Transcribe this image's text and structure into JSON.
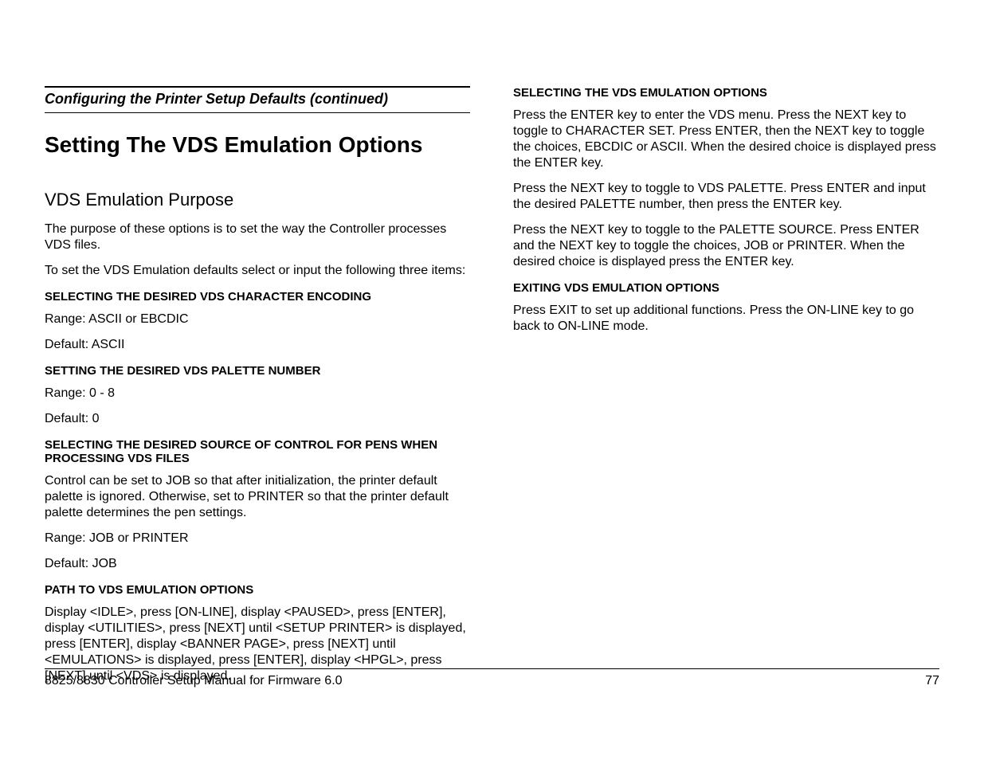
{
  "left": {
    "header": "Configuring the Printer Setup Defaults (continued)",
    "title": "Setting The VDS Emulation Options",
    "subtitle": "VDS Emulation Purpose",
    "p1": "The purpose of these options is to set the way the Controller processes VDS files.",
    "p2": "To set the VDS Emulation defaults select or input the following three items:",
    "s1h": "SELECTING THE DESIRED VDS CHARACTER ENCODING",
    "s1a": "Range: ASCII or EBCDIC",
    "s1b": "Default: ASCII",
    "s2h": "SETTING THE DESIRED VDS PALETTE NUMBER",
    "s2a": "Range: 0 - 8",
    "s2b": "Default: 0",
    "s3h": "SELECTING THE DESIRED SOURCE OF CONTROL FOR PENS WHEN PROCESSING VDS FILES",
    "s3a": "Control can be set to JOB so that after initialization, the printer default palette is ignored. Otherwise, set to PRINTER so that the printer default palette determines the pen settings.",
    "s3b": "Range: JOB or PRINTER",
    "s3c": "Default: JOB",
    "s4h": "PATH TO VDS EMULATION OPTIONS",
    "s4a": "Display <IDLE>, press [ON-LINE], display <PAUSED>, press [ENTER], display <UTILITIES>, press [NEXT] until <SETUP PRINTER> is displayed, press [ENTER], display <BANNER PAGE>, press [NEXT] until <EMULATIONS> is displayed, press [ENTER], display <HPGL>, press [NEXT] until <VDS> is displayed."
  },
  "right": {
    "s1h": "SELECTING THE VDS EMULATION OPTIONS",
    "s1a": "Press the ENTER key to enter the VDS menu.  Press the NEXT key to toggle to CHARACTER SET.  Press ENTER, then the NEXT key to toggle the choices, EBCDIC or ASCII.  When the desired choice is displayed press the ENTER key.",
    "s1b": "Press the NEXT key to toggle to VDS PALETTE.  Press ENTER and input the desired PALETTE number, then press the ENTER key.",
    "s1c": "Press the NEXT key to toggle to the PALETTE SOURCE.  Press ENTER and the NEXT key to toggle the choices, JOB or PRINTER.  When the desired choice is displayed press the ENTER key.",
    "s2h": "EXITING VDS EMULATION OPTIONS",
    "s2a": "Press EXIT to set up additional functions.  Press the ON-LINE key to go back to ON-LINE mode."
  },
  "footer": {
    "left": "8825/8830 Controller Setup Manual for Firmware 6.0",
    "right": "77"
  }
}
